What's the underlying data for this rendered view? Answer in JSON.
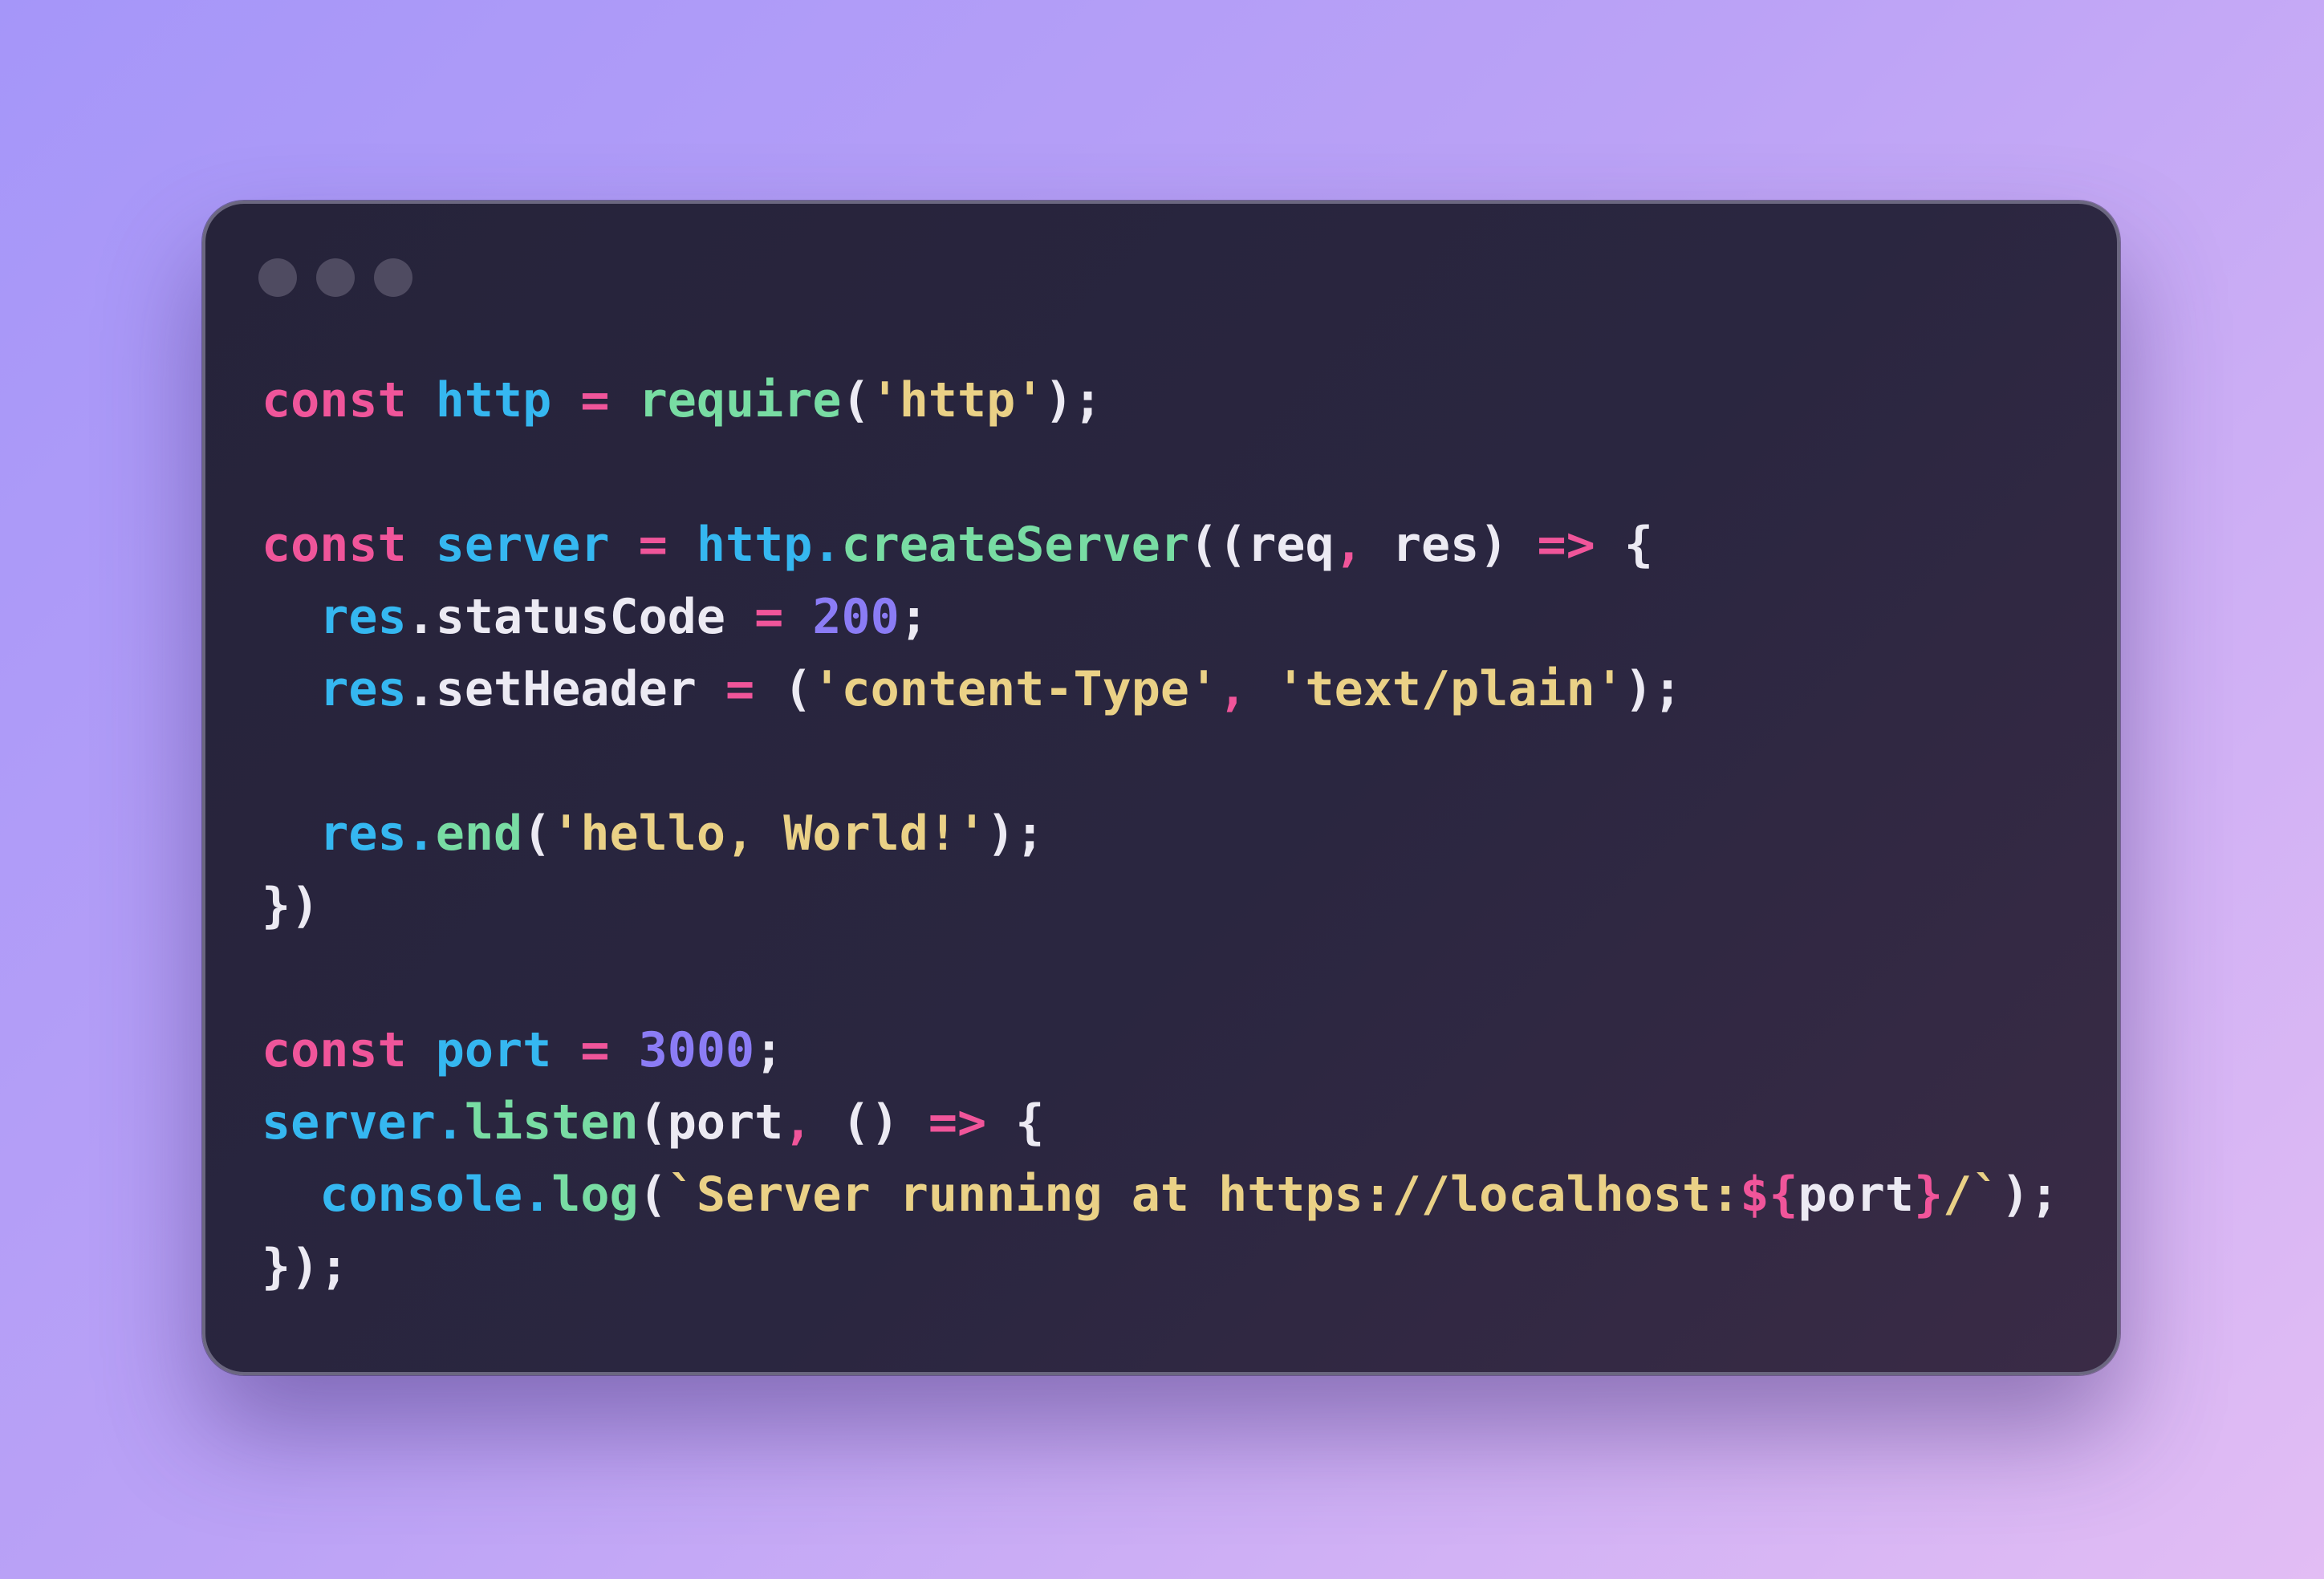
{
  "window": {
    "controls": [
      "close",
      "minimize",
      "maximize"
    ]
  },
  "colors": {
    "keyword": "#f0559a",
    "variable": "#35b7f0",
    "function": "#78dca3",
    "string": "#ead186",
    "number": "#8b7cf5",
    "plain": "#eceaf3",
    "background": "#2a2640"
  },
  "code": {
    "lines": [
      {
        "tokens": [
          {
            "t": "const",
            "k": "kw"
          },
          {
            "t": " ",
            "k": "pl"
          },
          {
            "t": "http",
            "k": "var"
          },
          {
            "t": " ",
            "k": "pl"
          },
          {
            "t": "=",
            "k": "op"
          },
          {
            "t": " ",
            "k": "pl"
          },
          {
            "t": "require",
            "k": "fn"
          },
          {
            "t": "(",
            "k": "pl"
          },
          {
            "t": "'http'",
            "k": "str"
          },
          {
            "t": ");",
            "k": "pl"
          }
        ]
      },
      {
        "tokens": []
      },
      {
        "tokens": [
          {
            "t": "const",
            "k": "kw"
          },
          {
            "t": " ",
            "k": "pl"
          },
          {
            "t": "server",
            "k": "var"
          },
          {
            "t": " ",
            "k": "pl"
          },
          {
            "t": "=",
            "k": "op"
          },
          {
            "t": " ",
            "k": "pl"
          },
          {
            "t": "http.",
            "k": "var"
          },
          {
            "t": "createServer",
            "k": "fn"
          },
          {
            "t": "((req",
            "k": "pl"
          },
          {
            "t": ",",
            "k": "op"
          },
          {
            "t": " res) ",
            "k": "pl"
          },
          {
            "t": "=>",
            "k": "op"
          },
          {
            "t": " {",
            "k": "pl"
          }
        ]
      },
      {
        "tokens": [
          {
            "t": "  ",
            "k": "pl"
          },
          {
            "t": "res",
            "k": "var"
          },
          {
            "t": ".statusCode ",
            "k": "pl"
          },
          {
            "t": "=",
            "k": "op"
          },
          {
            "t": " ",
            "k": "pl"
          },
          {
            "t": "200",
            "k": "num"
          },
          {
            "t": ";",
            "k": "pl"
          }
        ]
      },
      {
        "tokens": [
          {
            "t": "  ",
            "k": "pl"
          },
          {
            "t": "res",
            "k": "var"
          },
          {
            "t": ".setHeader ",
            "k": "pl"
          },
          {
            "t": "=",
            "k": "op"
          },
          {
            "t": " (",
            "k": "pl"
          },
          {
            "t": "'content-Type'",
            "k": "str"
          },
          {
            "t": ",",
            "k": "op"
          },
          {
            "t": " ",
            "k": "pl"
          },
          {
            "t": "'text/plain'",
            "k": "str"
          },
          {
            "t": ");",
            "k": "pl"
          }
        ]
      },
      {
        "tokens": []
      },
      {
        "tokens": [
          {
            "t": "  ",
            "k": "pl"
          },
          {
            "t": "res.",
            "k": "var"
          },
          {
            "t": "end",
            "k": "fn"
          },
          {
            "t": "(",
            "k": "pl"
          },
          {
            "t": "'hello, World!'",
            "k": "str"
          },
          {
            "t": ");",
            "k": "pl"
          }
        ]
      },
      {
        "tokens": [
          {
            "t": "})",
            "k": "pl"
          }
        ]
      },
      {
        "tokens": []
      },
      {
        "tokens": [
          {
            "t": "const",
            "k": "kw"
          },
          {
            "t": " ",
            "k": "pl"
          },
          {
            "t": "port",
            "k": "var"
          },
          {
            "t": " ",
            "k": "pl"
          },
          {
            "t": "=",
            "k": "op"
          },
          {
            "t": " ",
            "k": "pl"
          },
          {
            "t": "3000",
            "k": "num"
          },
          {
            "t": ";",
            "k": "pl"
          }
        ]
      },
      {
        "tokens": [
          {
            "t": "server.",
            "k": "var"
          },
          {
            "t": "listen",
            "k": "fn"
          },
          {
            "t": "(port",
            "k": "pl"
          },
          {
            "t": ",",
            "k": "op"
          },
          {
            "t": " () ",
            "k": "pl"
          },
          {
            "t": "=>",
            "k": "op"
          },
          {
            "t": " {",
            "k": "pl"
          }
        ]
      },
      {
        "tokens": [
          {
            "t": "  ",
            "k": "pl"
          },
          {
            "t": "console.",
            "k": "var"
          },
          {
            "t": "log",
            "k": "fn"
          },
          {
            "t": "(",
            "k": "pl"
          },
          {
            "t": "`Server running at https://localhost:",
            "k": "str"
          },
          {
            "t": "${",
            "k": "tpl"
          },
          {
            "t": "port",
            "k": "pl"
          },
          {
            "t": "}",
            "k": "tpl"
          },
          {
            "t": "/`",
            "k": "str"
          },
          {
            "t": ");",
            "k": "pl"
          }
        ]
      },
      {
        "tokens": [
          {
            "t": "});",
            "k": "pl"
          }
        ]
      }
    ]
  }
}
